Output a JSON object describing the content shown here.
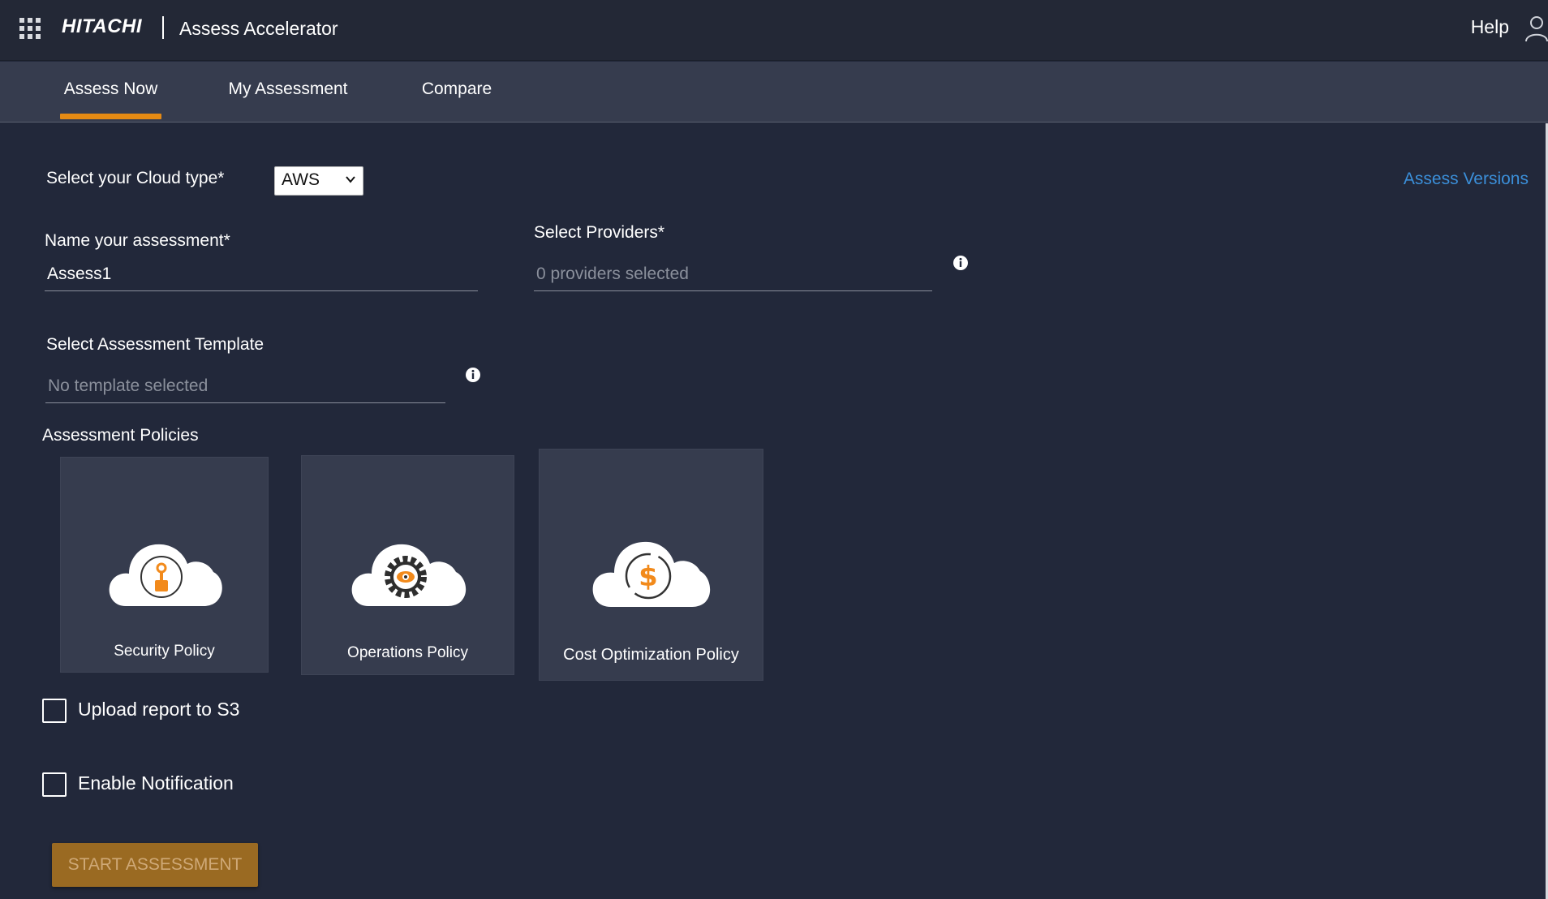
{
  "header": {
    "brand": "HITACHI",
    "app_title": "Assess Accelerator",
    "help_label": "Help"
  },
  "tabs": [
    {
      "label": "Assess Now",
      "active": true
    },
    {
      "label": "My Assessment",
      "active": false
    },
    {
      "label": "Compare",
      "active": false
    }
  ],
  "form": {
    "cloud_type_label": "Select your Cloud type*",
    "cloud_type_value": "AWS",
    "assess_versions_link": "Assess Versions",
    "name_label": "Name your assessment*",
    "name_value": "Assess1",
    "providers_label": "Select Providers*",
    "providers_placeholder": "0 providers selected",
    "template_label": "Select Assessment Template",
    "template_placeholder": "No template selected",
    "policies_label": "Assessment Policies"
  },
  "policies": [
    {
      "label": "Security Policy",
      "icon": "security-cloud-icon"
    },
    {
      "label": "Operations Policy",
      "icon": "operations-cloud-icon"
    },
    {
      "label": "Cost Optimization Policy",
      "icon": "cost-cloud-icon"
    }
  ],
  "options": {
    "upload_label": "Upload report to S3",
    "upload_checked": false,
    "notify_label": "Enable Notification",
    "notify_checked": false
  },
  "actions": {
    "start_label": "START ASSESSMENT"
  },
  "colors": {
    "accent": "#e58a13",
    "link": "#3b8fd9",
    "background": "#22283a",
    "card": "#363c4e"
  }
}
